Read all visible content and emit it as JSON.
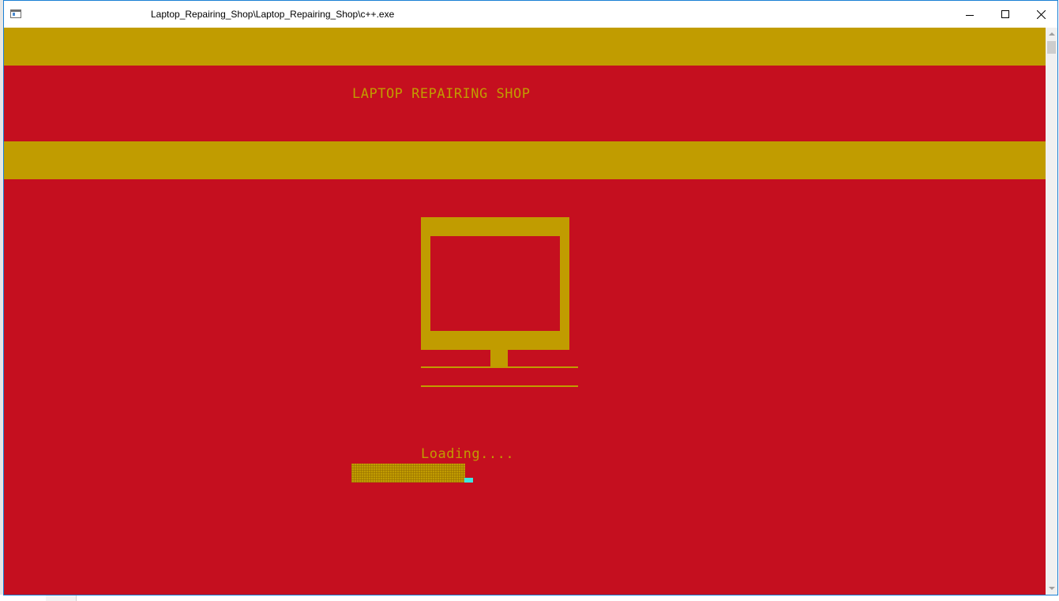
{
  "window": {
    "title": "Laptop_Repairing_Shop\\Laptop_Repairing_Shop\\c++.exe",
    "icon": "console-app-icon",
    "controls": [
      "minimize-icon",
      "maximize-icon",
      "close-icon"
    ]
  },
  "console": {
    "shop_title": "LAPTOP REPAIRING SHOP",
    "loading_label": "Loading....",
    "progress": 0.93,
    "colors": {
      "background": "#c50f1f",
      "accent": "#c19c00",
      "cursor": "#3ee6e0"
    }
  }
}
